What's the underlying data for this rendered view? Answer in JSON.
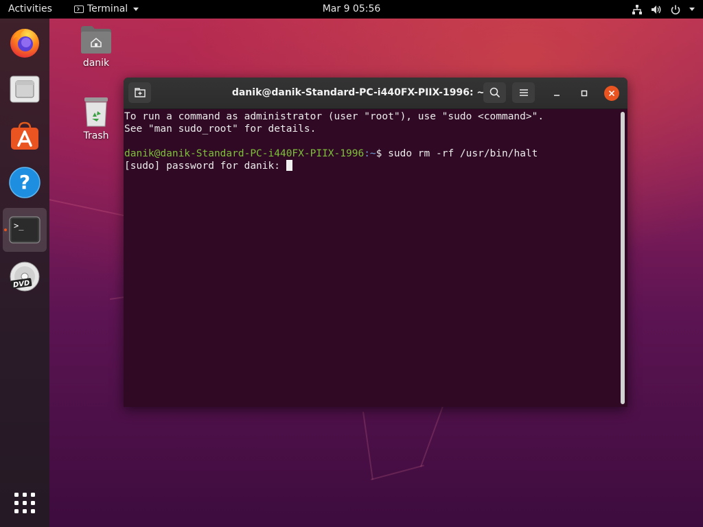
{
  "topbar": {
    "activities": "Activities",
    "app_name": "Terminal",
    "clock": "Mar 9  05:56"
  },
  "dock": {
    "items": [
      {
        "name": "Firefox Web Browser"
      },
      {
        "name": "Files"
      },
      {
        "name": "Ubuntu Software"
      },
      {
        "name": "Help"
      },
      {
        "name": "Terminal",
        "running": true
      },
      {
        "name": "DVD"
      }
    ],
    "show_apps": "Show Applications"
  },
  "desktop": {
    "home_label": "danik",
    "trash_label": "Trash"
  },
  "terminal": {
    "title": "danik@danik-Standard-PC-i440FX-PIIX-1996: ~",
    "lines": [
      "To run a command as administrator (user \"root\"), use \"sudo <command>\".",
      "See \"man sudo_root\" for details."
    ],
    "prompt_user": "danik@danik-Standard-PC-i440FX-PIIX-1996",
    "prompt_path": ":~",
    "prompt_sign": "$ ",
    "command": "sudo rm -rf /usr/bin/halt",
    "password_prompt": "[sudo] password for danik: "
  },
  "colors": {
    "accent": "#e95420",
    "terminal_bg": "#300a24",
    "prompt_user": "#7ec13a",
    "prompt_path": "#72a0d8"
  }
}
